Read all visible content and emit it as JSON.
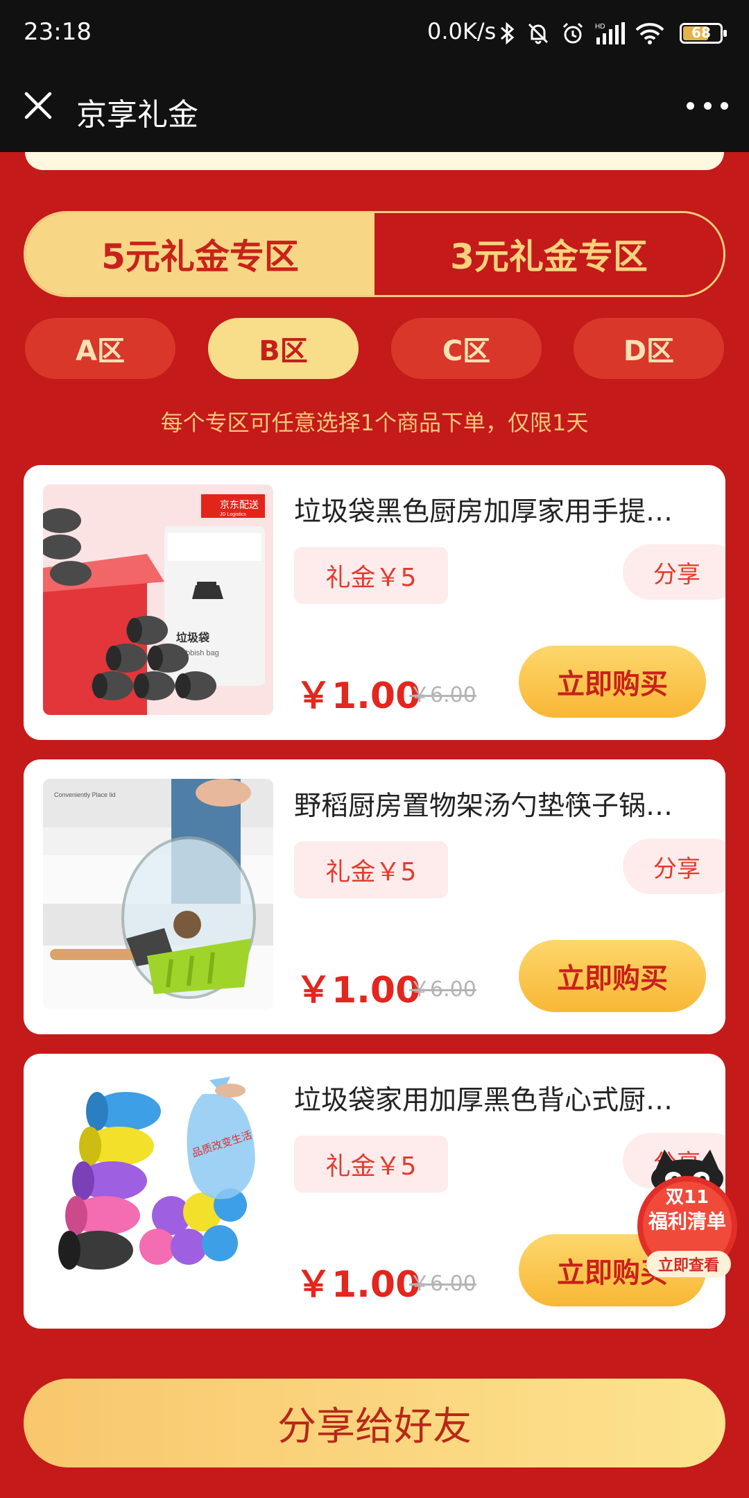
{
  "status_bar": {
    "time": "23:18",
    "network_speed": "0.0K/s",
    "battery": "68"
  },
  "header": {
    "title": "京享礼金"
  },
  "zones": {
    "tab_5": "5元礼金专区",
    "tab_3": "3元礼金专区"
  },
  "sub_zones": [
    "A区",
    "B区",
    "C区",
    "D区"
  ],
  "notice": "每个专区可任意选择1个商品下单，仅限1天",
  "products": [
    {
      "title": "垃圾袋黑色厨房加厚家用手提…",
      "gift": "礼金￥5",
      "share": "分享",
      "price": "￥1.00",
      "old_price": "￥6.00",
      "buy": "立即购买",
      "image_badge": "京东配送",
      "image_sub": "JD Logistics",
      "image_label": "垃圾袋",
      "image_label2": "Rubbish bag"
    },
    {
      "title": "野稻厨房置物架汤勺垫筷子锅…",
      "gift": "礼金￥5",
      "share": "分享",
      "price": "￥1.00",
      "old_price": "￥6.00",
      "buy": "立即购买",
      "image_caption": "Conveniently Place lid"
    },
    {
      "title": "垃圾袋家用加厚黑色背心式厨…",
      "gift": "礼金￥5",
      "share": "分享",
      "price": "￥1.00",
      "old_price": "￥6.00",
      "buy": "立即购买",
      "image_caption": "品质改变生活"
    }
  ],
  "promo": {
    "line1": "双11",
    "line2": "福利清单",
    "cta": "立即查看"
  },
  "share_button": "分享给好友"
}
